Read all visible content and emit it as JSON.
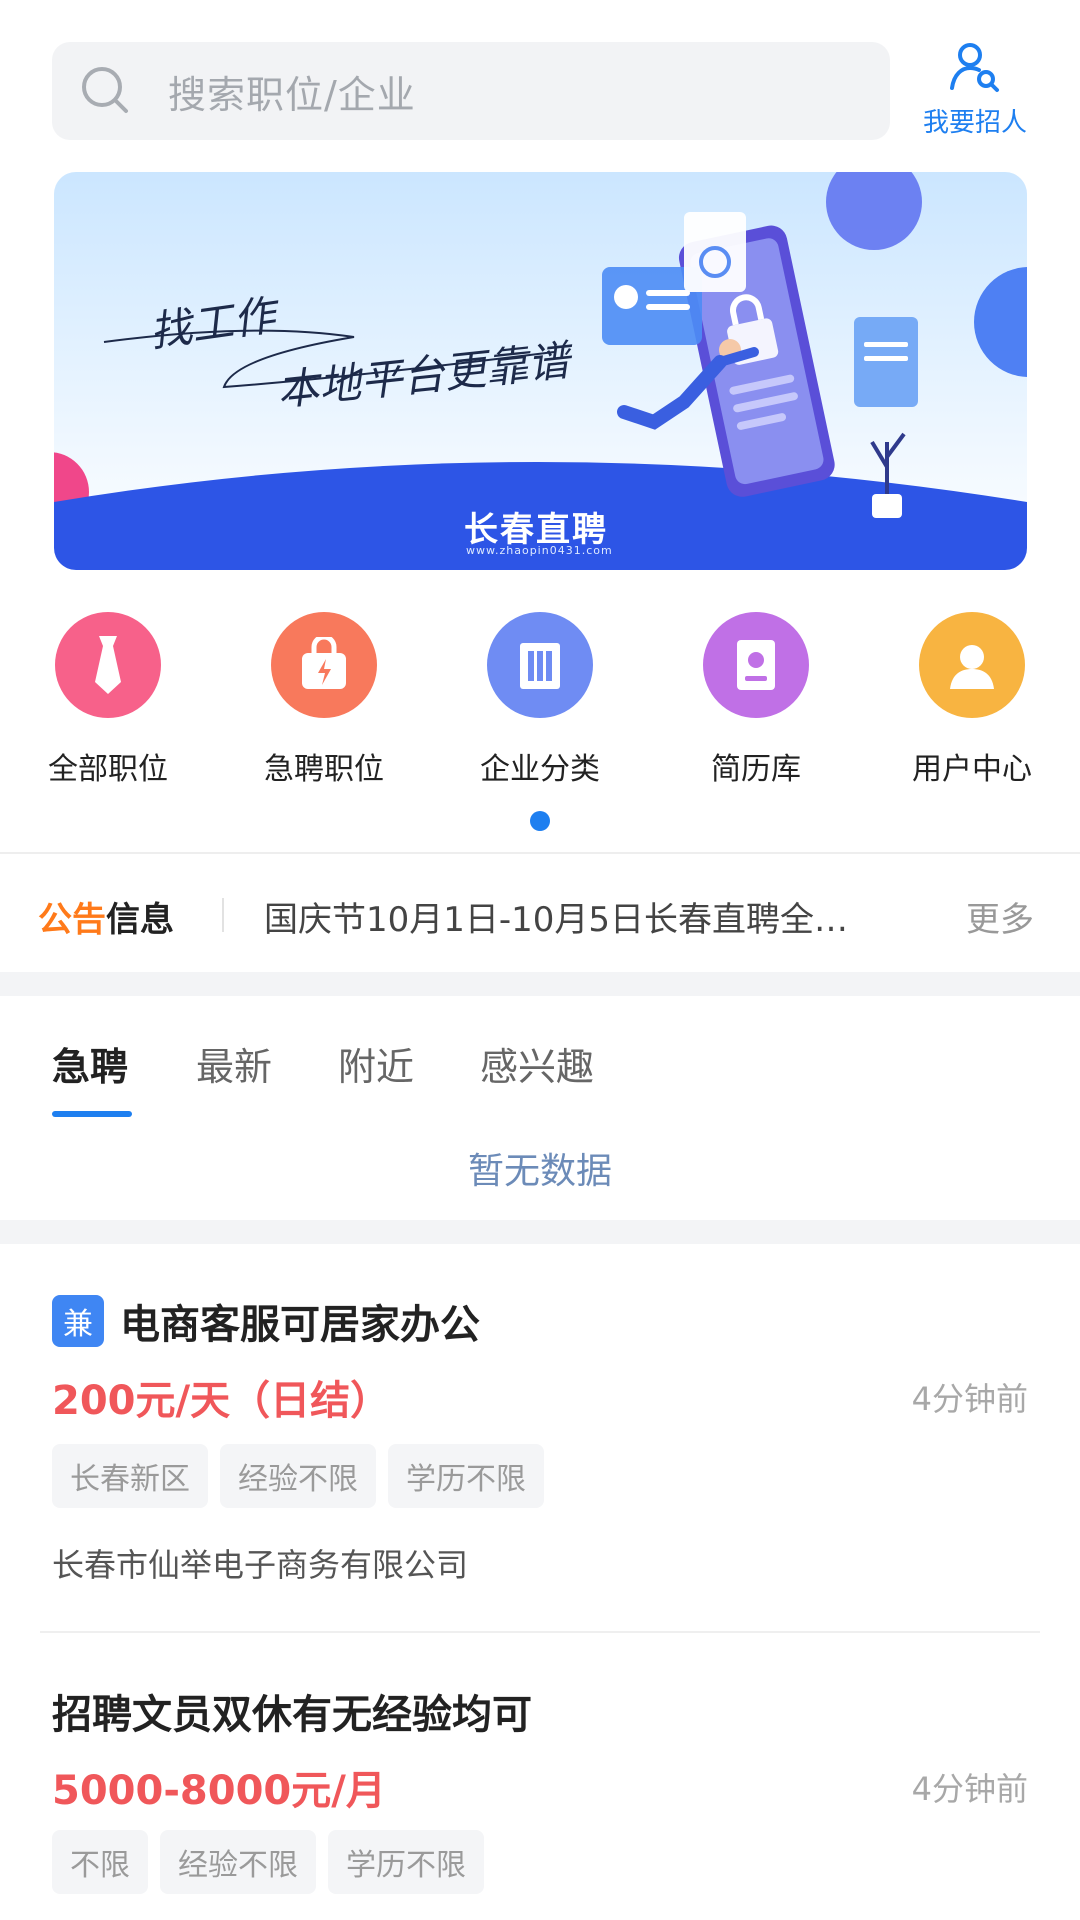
{
  "header": {
    "search_placeholder": "搜索职位/企业",
    "recruit_label": "我要招人"
  },
  "banner": {
    "line1": "找工作",
    "line2": "本地平台更靠谱",
    "brand": "长春直聘",
    "url": "www.zhaopin0431.com"
  },
  "nav": {
    "items": [
      {
        "label": "全部职位",
        "icon": "tie-icon",
        "color": "#f7618a"
      },
      {
        "label": "急聘职位",
        "icon": "urgent-bag-icon",
        "color": "#f8795c"
      },
      {
        "label": "企业分类",
        "icon": "building-icon",
        "color": "#6f8cf3"
      },
      {
        "label": "简历库",
        "icon": "resume-book-icon",
        "color": "#c070e6"
      },
      {
        "label": "用户中心",
        "icon": "user-icon",
        "color": "#f8b441"
      }
    ]
  },
  "notice": {
    "tag_a": "公告",
    "tag_b": "信息",
    "text": "国庆节10月1日-10月5日长春直聘全…",
    "more": "更多"
  },
  "tabs": [
    "急聘",
    "最新",
    "附近",
    "感兴趣"
  ],
  "empty_text": "暂无数据",
  "jobs": [
    {
      "badge": "兼",
      "title": "电商客服可居家办公",
      "salary": "200元/天（日结）",
      "time": "4分钟前",
      "tags": [
        "长春新区",
        "经验不限",
        "学历不限"
      ],
      "company": "长春市仙举电子商务有限公司"
    },
    {
      "title": "招聘文员双休有无经验均可",
      "salary": "5000-8000元/月",
      "time": "4分钟前",
      "tags": [
        "不限",
        "经验不限",
        "学历不限"
      ]
    }
  ]
}
